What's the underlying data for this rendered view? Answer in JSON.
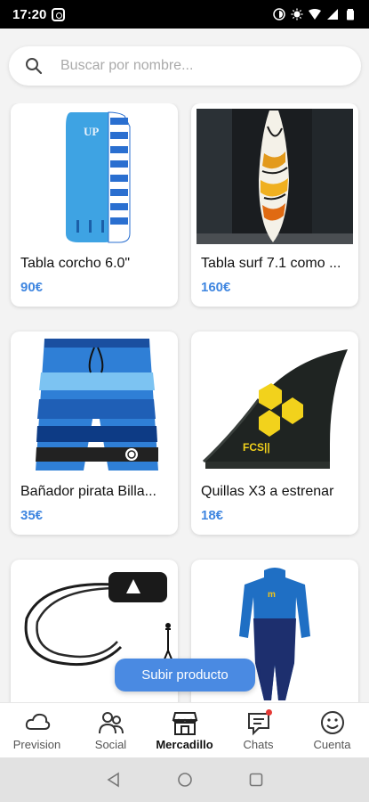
{
  "status_bar": {
    "time": "17:20"
  },
  "search": {
    "placeholder": "Buscar por nombre..."
  },
  "products": [
    {
      "title": "Tabla corcho 6.0\"",
      "price": "90€",
      "image_icon": "softboard-image"
    },
    {
      "title": "Tabla surf 7.1 como ...",
      "price": "160€",
      "image_icon": "surfboard-image"
    },
    {
      "title": "Bañador pirata Billa...",
      "price": "35€",
      "image_icon": "boardshorts-image"
    },
    {
      "title": "Quillas X3 a estrenar",
      "price": "18€",
      "image_icon": "fins-image"
    },
    {
      "title": "",
      "price": "",
      "image_icon": "leash-image"
    },
    {
      "title": "",
      "price": "",
      "image_icon": "wetsuit-image"
    }
  ],
  "fab": {
    "label": "Subir producto"
  },
  "bottom_nav": {
    "items": [
      {
        "label": "Prevision",
        "icon": "cloud-icon"
      },
      {
        "label": "Social",
        "icon": "people-icon"
      },
      {
        "label": "Mercadillo",
        "icon": "store-icon"
      },
      {
        "label": "Chats",
        "icon": "chat-icon"
      },
      {
        "label": "Cuenta",
        "icon": "smiley-icon"
      }
    ],
    "active": "Mercadillo"
  },
  "colors": {
    "accent": "#4a8ae2",
    "price": "#3f86e0",
    "notification": "#e53935"
  }
}
